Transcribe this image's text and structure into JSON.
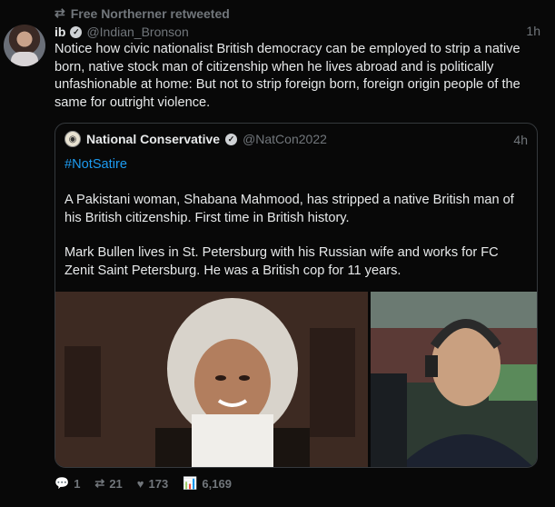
{
  "retweet": {
    "icon": "retweet-icon",
    "text": "Free Northerner retweeted"
  },
  "tweet": {
    "author_name": "ib",
    "author_handle": "@Indian_Bronson",
    "time": "1h",
    "text": "Notice how civic nationalist British democracy can be employed to strip a native born, native stock man of citizenship when he lives abroad and is politically unfashionable at home: But not to strip foreign born, foreign origin people of the same for outright violence."
  },
  "quote": {
    "author_name": "National Conservative",
    "author_handle": "@NatCon2022",
    "time": "4h",
    "hashtag": "#NotSatire",
    "para1": "A Pakistani woman, Shabana Mahmood, has stripped a native British man of his British citizenship. First time in British history.",
    "para2": "Mark Bullen lives in St. Petersburg with his Russian wife and works for FC Zenit Saint Petersburg. He was a British cop for 11 years."
  },
  "actions": {
    "replies": "1",
    "retweets": "21",
    "likes": "173",
    "views": "6,169"
  },
  "colors": {
    "accent": "#1d9bf0",
    "muted": "#71767b",
    "background": "#080808"
  }
}
